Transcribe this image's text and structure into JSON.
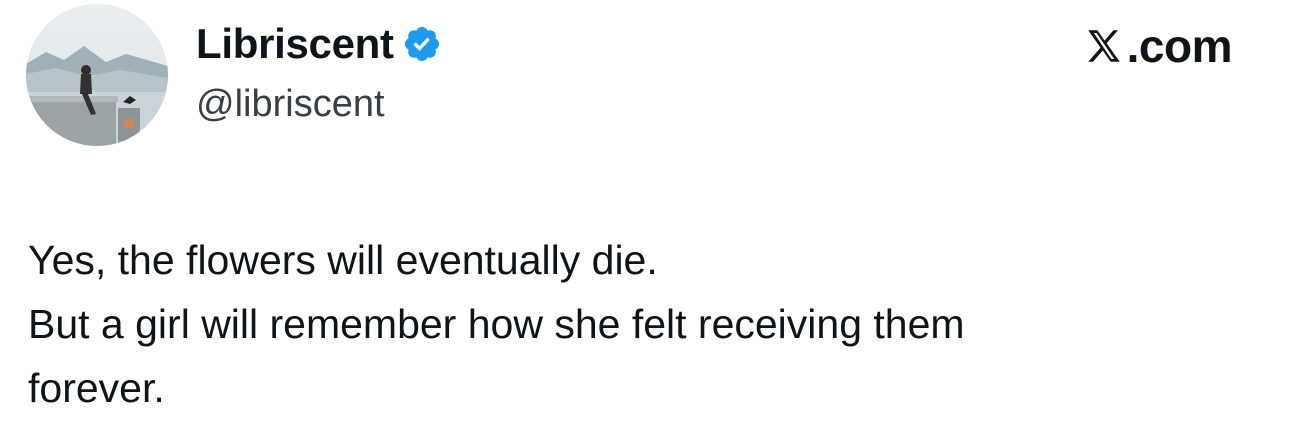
{
  "profile": {
    "display_name": "Libriscent",
    "handle": "@libriscent",
    "verified": true,
    "verified_color": "#1d9bf0",
    "avatar_icon": "avatar-photo"
  },
  "brand": {
    "label": ".com",
    "icon": "x-logo-icon"
  },
  "tweet": {
    "lines": [
      "Yes, the flowers will eventually die.",
      "But a girl will remember how she felt receiving them",
      "forever."
    ]
  }
}
